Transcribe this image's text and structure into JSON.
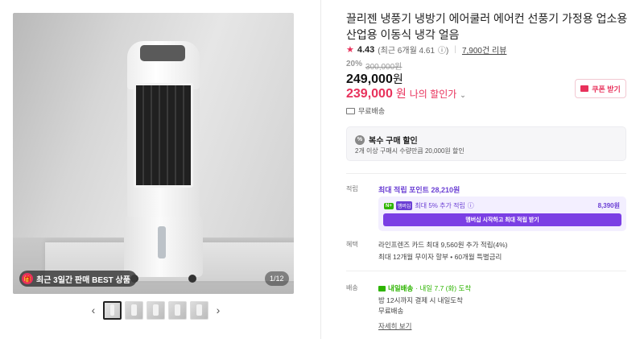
{
  "gallery": {
    "badge": "최근 3일간 판매 BEST 상품",
    "counter": "1/12",
    "prev": "‹",
    "next": "›"
  },
  "product": {
    "title": "끌리젠 냉풍기 냉방기 에어쿨러 에어컨 선풍기 가정용 업소용 산업용 이동식 냉각 얼음",
    "rating": "4.43",
    "rating_recent": "(최근 6개월 4.61",
    "rating_info": "ⓘ)",
    "reviews": "7,900건 리뷰",
    "discount_rate": "20%",
    "original_price": "300,000원",
    "price": "249,000",
    "price_unit": "원",
    "my_price": "239,000",
    "my_price_unit": "원",
    "my_price_label": "나의 할인가",
    "coupon_button": "쿠폰 받기",
    "shipping_free": "무료배송"
  },
  "multi_discount": {
    "title": "복수 구매 할인",
    "desc": "2개 이상 구매시 수량만큼 20,000원 할인"
  },
  "points": {
    "label": "적립",
    "title": "최대 적립 포인트 28,210원",
    "tag_n": "N+",
    "tag_member": "멤버십",
    "extra": "최대 5% 추가 적립",
    "amount": "8,390원",
    "cta": "멤버십 시작하고 최대 적립 받기"
  },
  "benefits": {
    "label": "혜택",
    "line1": "라인프렌즈 카드 최대 9,560원 추가 적립(4%)",
    "line2": "최대 12개월 무이자 할부 • 60개월 특별금리"
  },
  "delivery": {
    "label": "배송",
    "badge": "내일배송",
    "date": "· 내일 7.7 (화) 도착",
    "line2": "밤 12시까지 결제 시 내일도착",
    "line3": "무료배송",
    "more": "자세히 보기"
  },
  "colors": {
    "accent": "#e8315b",
    "purple": "#6b3fd4",
    "green": "#2db400"
  }
}
